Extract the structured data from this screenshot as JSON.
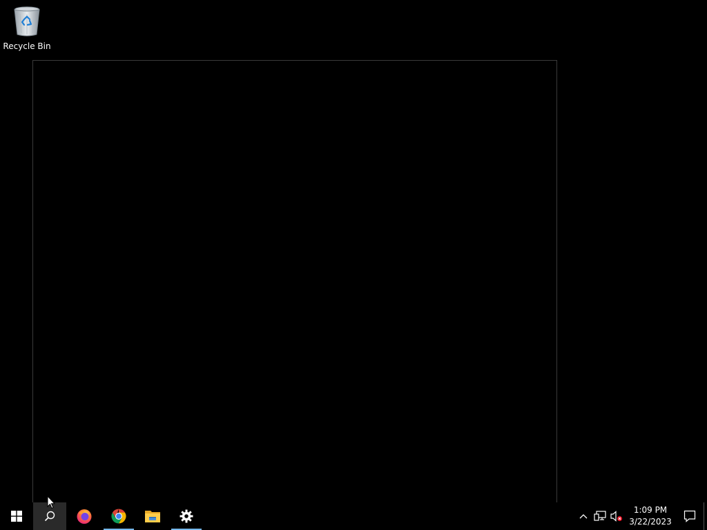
{
  "desktop": {
    "icons": [
      {
        "label": "Recycle Bin",
        "icon": "recycle-bin-icon"
      }
    ]
  },
  "taskbar": {
    "start": {
      "icon": "windows-logo-icon"
    },
    "search": {
      "icon": "search-icon"
    },
    "apps": [
      {
        "name": "Firefox",
        "icon": "firefox-icon",
        "running": false
      },
      {
        "name": "Google Chrome",
        "icon": "chrome-icon",
        "running": true
      },
      {
        "name": "File Explorer",
        "icon": "file-explorer-icon",
        "running": false
      },
      {
        "name": "Settings",
        "icon": "settings-gear-icon",
        "running": true
      }
    ],
    "accent_color": "#76b9ed"
  },
  "tray": {
    "icons": [
      "chevron-up-icon",
      "network-icon",
      "volume-muted-icon"
    ],
    "time": "1:09 PM",
    "date": "3/22/2023",
    "notifications_icon": "action-center-icon"
  }
}
